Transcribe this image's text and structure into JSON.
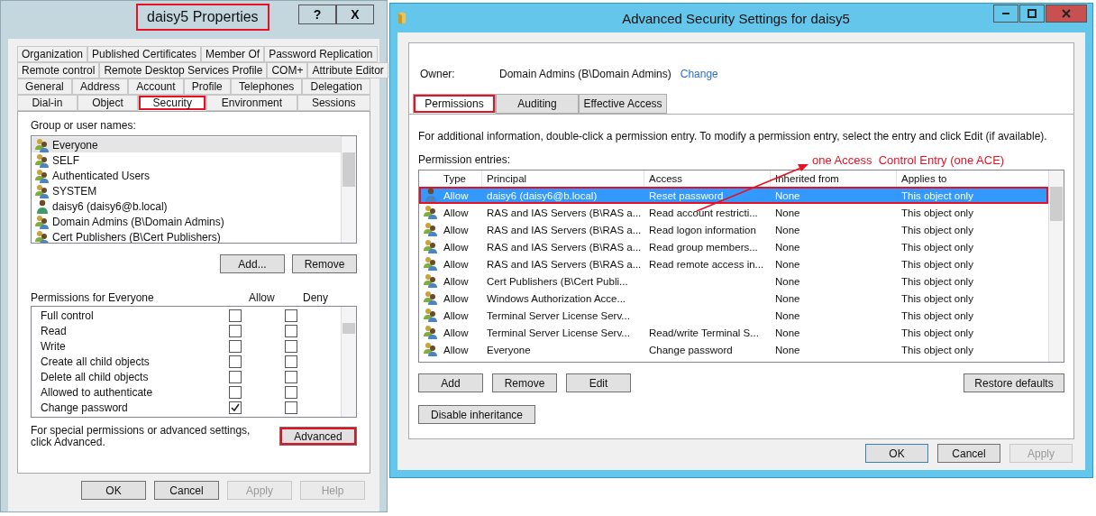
{
  "properties_window": {
    "title": "daisy5 Properties",
    "title_highlighted": true,
    "help_button": "?",
    "close_button": "X",
    "tab_rows": [
      [
        {
          "label": "Organization",
          "selected": false,
          "highlighted": false
        },
        {
          "label": "Published Certificates",
          "selected": false,
          "highlighted": false
        },
        {
          "label": "Member Of",
          "selected": false,
          "highlighted": false
        },
        {
          "label": "Password Replication",
          "selected": false,
          "highlighted": false
        }
      ],
      [
        {
          "label": "Remote control",
          "selected": false,
          "highlighted": false
        },
        {
          "label": "Remote Desktop Services Profile",
          "selected": false,
          "highlighted": false
        },
        {
          "label": "COM+",
          "selected": false,
          "highlighted": false
        },
        {
          "label": "Attribute Editor",
          "selected": false,
          "highlighted": false
        }
      ],
      [
        {
          "label": "General",
          "selected": false,
          "highlighted": false
        },
        {
          "label": "Address",
          "selected": false,
          "highlighted": false
        },
        {
          "label": "Account",
          "selected": false,
          "highlighted": false
        },
        {
          "label": "Profile",
          "selected": false,
          "highlighted": false
        },
        {
          "label": "Telephones",
          "selected": false,
          "highlighted": false
        },
        {
          "label": "Delegation",
          "selected": false,
          "highlighted": false
        }
      ],
      [
        {
          "label": "Dial-in",
          "selected": false,
          "highlighted": false
        },
        {
          "label": "Object",
          "selected": false,
          "highlighted": false
        },
        {
          "label": "Security",
          "selected": true,
          "highlighted": true
        },
        {
          "label": "Environment",
          "selected": false,
          "highlighted": false
        },
        {
          "label": "Sessions",
          "selected": false,
          "highlighted": false
        }
      ]
    ],
    "group_label": "Group or user names:",
    "principals": [
      {
        "name": "Everyone",
        "kind": "group",
        "selected": true
      },
      {
        "name": "SELF",
        "kind": "group",
        "selected": false
      },
      {
        "name": "Authenticated Users",
        "kind": "group",
        "selected": false
      },
      {
        "name": "SYSTEM",
        "kind": "group",
        "selected": false
      },
      {
        "name": "daisy6 (daisy6@b.local)",
        "kind": "user",
        "selected": false
      },
      {
        "name": "Domain Admins (B\\Domain Admins)",
        "kind": "group",
        "selected": false
      },
      {
        "name": "Cert Publishers (B\\Cert Publishers)",
        "kind": "group",
        "selected": false
      }
    ],
    "principal_buttons": [
      "Add...",
      "Remove"
    ],
    "permissions_label": "Permissions for Everyone",
    "allow_header": "Allow",
    "deny_header": "Deny",
    "permissions": [
      {
        "name": "Full control",
        "allow": false,
        "deny": false
      },
      {
        "name": "Read",
        "allow": false,
        "deny": false
      },
      {
        "name": "Write",
        "allow": false,
        "deny": false
      },
      {
        "name": "Create all child objects",
        "allow": false,
        "deny": false
      },
      {
        "name": "Delete all child objects",
        "allow": false,
        "deny": false
      },
      {
        "name": "Allowed to authenticate",
        "allow": false,
        "deny": false
      },
      {
        "name": "Change password",
        "allow": true,
        "deny": false
      }
    ],
    "advanced_note": "For special permissions or advanced settings, click Advanced.",
    "advanced_button": {
      "label": "Advanced",
      "highlighted": true
    },
    "buttons": [
      {
        "label": "OK",
        "disabled": false
      },
      {
        "label": "Cancel",
        "disabled": false
      },
      {
        "label": "Apply",
        "disabled": true
      },
      {
        "label": "Help",
        "disabled": true
      }
    ]
  },
  "advanced_window": {
    "title": "Advanced Security Settings for daisy5",
    "owner_label": "Owner:",
    "owner": "Domain Admins (B\\Domain Admins)",
    "owner_link": "Change",
    "tabs": [
      {
        "label": "Permissions",
        "selected": true,
        "highlighted": true
      },
      {
        "label": "Auditing",
        "selected": false,
        "highlighted": false
      },
      {
        "label": "Effective Access",
        "selected": false,
        "highlighted": false
      }
    ],
    "description": "For additional information, double-click a permission entry. To modify a permission entry, select the entry and click Edit (if available).",
    "entries_label": "Permission entries:",
    "columns": [
      "Type",
      "Principal",
      "Access",
      "Inherited from",
      "Applies to"
    ],
    "entries": [
      {
        "kind": "user",
        "type": "Allow",
        "principal": "daisy6 (daisy6@b.local)",
        "access": "Reset password",
        "inherited": "None",
        "applies": "This object only",
        "selected": true,
        "highlighted": true
      },
      {
        "kind": "group",
        "type": "Allow",
        "principal": "RAS and IAS Servers (B\\RAS a...",
        "access": "Read account restricti...",
        "inherited": "None",
        "applies": "This object only",
        "selected": false,
        "highlighted": false
      },
      {
        "kind": "group",
        "type": "Allow",
        "principal": "RAS and IAS Servers (B\\RAS a...",
        "access": "Read logon information",
        "inherited": "None",
        "applies": "This object only",
        "selected": false,
        "highlighted": false
      },
      {
        "kind": "group",
        "type": "Allow",
        "principal": "RAS and IAS Servers (B\\RAS a...",
        "access": "Read group members...",
        "inherited": "None",
        "applies": "This object only",
        "selected": false,
        "highlighted": false
      },
      {
        "kind": "group",
        "type": "Allow",
        "principal": "RAS and IAS Servers (B\\RAS a...",
        "access": "Read remote access in...",
        "inherited": "None",
        "applies": "This object only",
        "selected": false,
        "highlighted": false
      },
      {
        "kind": "group",
        "type": "Allow",
        "principal": "Cert Publishers (B\\Cert Publi...",
        "inherited": "None",
        "applies": "This object only",
        "selected": false,
        "highlighted": false
      },
      {
        "kind": "group",
        "type": "Allow",
        "principal": "Windows Authorization Acce...",
        "inherited": "None",
        "applies": "This object only",
        "selected": false,
        "highlighted": false
      },
      {
        "kind": "group",
        "type": "Allow",
        "principal": "Terminal Server License Serv...",
        "inherited": "None",
        "applies": "This object only",
        "selected": false,
        "highlighted": false
      },
      {
        "kind": "group",
        "type": "Allow",
        "principal": "Terminal Server License Serv...",
        "access": "Read/write Terminal S...",
        "inherited": "None",
        "applies": "This object only",
        "selected": false,
        "highlighted": false
      },
      {
        "kind": "group",
        "type": "Allow",
        "principal": "Everyone",
        "access": "Change password",
        "inherited": "None",
        "applies": "This object only",
        "selected": false,
        "highlighted": false
      }
    ],
    "entry_buttons": [
      "Add",
      "Remove",
      "Edit"
    ],
    "restore_button": "Restore defaults",
    "inheritance_button": "Disable inheritance",
    "buttons": [
      {
        "label": "OK",
        "disabled": false,
        "default": true
      },
      {
        "label": "Cancel",
        "disabled": false,
        "default": false
      },
      {
        "label": "Apply",
        "disabled": true,
        "default": false
      }
    ],
    "annotation": "one Access  Control Entry (one ACE)"
  }
}
